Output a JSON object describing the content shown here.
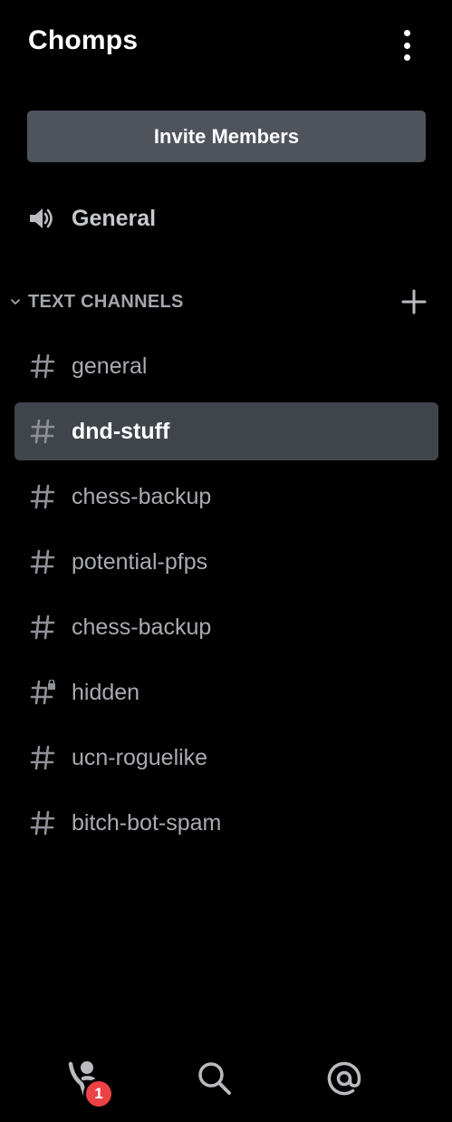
{
  "header": {
    "server_name": "Chomps",
    "menu_icon": "kebab-menu-icon"
  },
  "invite": {
    "label": "Invite Members"
  },
  "voice_channel": {
    "icon": "speaker-icon",
    "label": "General"
  },
  "category": {
    "label": "TEXT CHANNELS",
    "expanded": true,
    "add_icon": "plus-icon"
  },
  "channels": [
    {
      "name": "general",
      "icon": "hash-icon",
      "active": false
    },
    {
      "name": "dnd-stuff",
      "icon": "hash-icon",
      "active": true
    },
    {
      "name": "chess-backup",
      "icon": "hash-icon",
      "active": false
    },
    {
      "name": "potential-pfps",
      "icon": "hash-icon",
      "active": false
    },
    {
      "name": "chess-backup",
      "icon": "hash-icon",
      "active": false
    },
    {
      "name": "hidden",
      "icon": "hash-lock-icon",
      "active": false
    },
    {
      "name": "ucn-roguelike",
      "icon": "hash-icon",
      "active": false
    },
    {
      "name": "bitch-bot-spam",
      "icon": "hash-icon",
      "active": false
    }
  ],
  "bottom_nav": {
    "friends_icon": "friends-wave-icon",
    "friends_badge": "1",
    "search_icon": "search-icon",
    "mentions_icon": "at-mention-icon"
  },
  "colors": {
    "background": "#000000",
    "button": "#4f545c",
    "active_channel": "#40444b",
    "badge": "#ed4245",
    "text_primary": "#ffffff",
    "text_muted": "#a8abaf"
  }
}
